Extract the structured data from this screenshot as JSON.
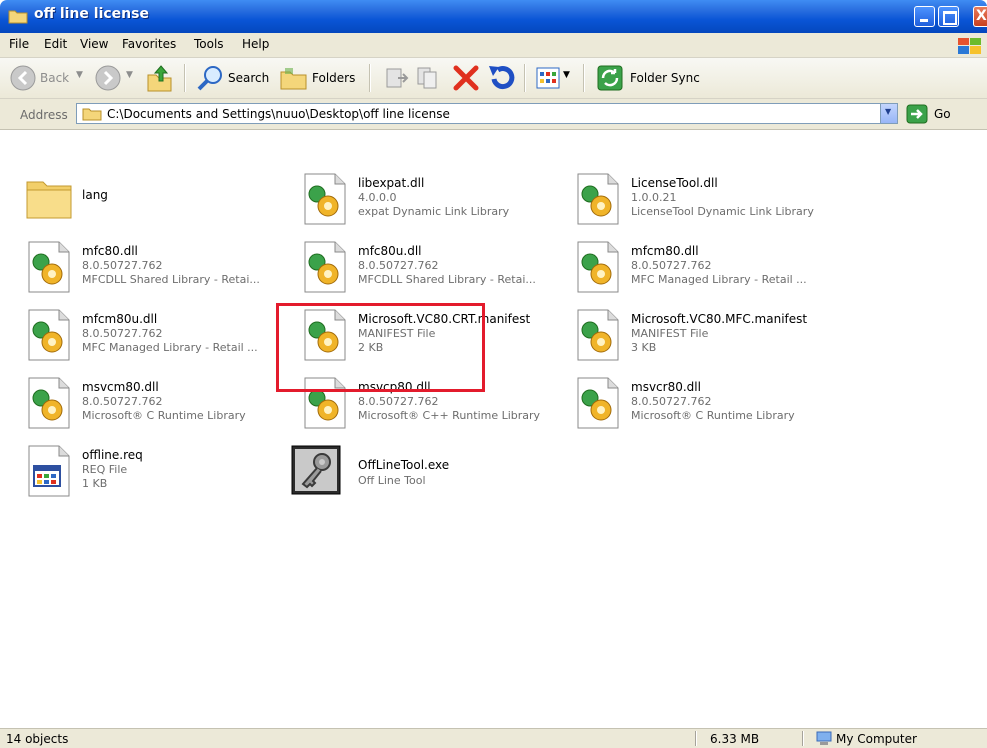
{
  "window": {
    "title": "off line license",
    "accent": "#0a55d6"
  },
  "menu": [
    "File",
    "Edit",
    "View",
    "Favorites",
    "Tools",
    "Help"
  ],
  "toolbar": {
    "back_label": "Back",
    "search_label": "Search",
    "folders_label": "Folders",
    "folder_sync_label": "Folder Sync"
  },
  "address": {
    "label": "Address",
    "path": "C:\\Documents and Settings\\nuuo\\Desktop\\off line license",
    "go_label": "Go"
  },
  "files": [
    {
      "name": "lang",
      "line2": "",
      "line3": "",
      "icon": "folder-icon"
    },
    {
      "name": "libexpat.dll",
      "line2": "4.0.0.0",
      "line3": "expat Dynamic Link Library",
      "icon": "dll-icon"
    },
    {
      "name": "LicenseTool.dll",
      "line2": "1.0.0.21",
      "line3": "LicenseTool Dynamic Link Library",
      "icon": "dll-icon"
    },
    {
      "name": "mfc80.dll",
      "line2": "8.0.50727.762",
      "line3": "MFCDLL Shared Library - Retai...",
      "icon": "dll-icon"
    },
    {
      "name": "mfc80u.dll",
      "line2": "8.0.50727.762",
      "line3": "MFCDLL Shared Library - Retai...",
      "icon": "dll-icon"
    },
    {
      "name": "mfcm80.dll",
      "line2": "8.0.50727.762",
      "line3": "MFC Managed Library - Retail ...",
      "icon": "dll-icon"
    },
    {
      "name": "mfcm80u.dll",
      "line2": "8.0.50727.762",
      "line3": "MFC Managed Library - Retail ...",
      "icon": "dll-icon"
    },
    {
      "name": "Microsoft.VC80.CRT.manifest",
      "line2": "MANIFEST File",
      "line3": "2 KB",
      "icon": "dll-icon"
    },
    {
      "name": "Microsoft.VC80.MFC.manifest",
      "line2": "MANIFEST File",
      "line3": "3 KB",
      "icon": "dll-icon"
    },
    {
      "name": "msvcm80.dll",
      "line2": "8.0.50727.762",
      "line3": "Microsoft® C Runtime Library",
      "icon": "dll-icon"
    },
    {
      "name": "msvcp80.dll",
      "line2": "8.0.50727.762",
      "line3": "Microsoft® C++ Runtime Library",
      "icon": "dll-icon"
    },
    {
      "name": "msvcr80.dll",
      "line2": "8.0.50727.762",
      "line3": "Microsoft® C Runtime Library",
      "icon": "dll-icon"
    },
    {
      "name": "offline.req",
      "line2": "REQ File",
      "line3": "1 KB",
      "icon": "req-file-icon"
    },
    {
      "name": "OffLineTool.exe",
      "line2": "Off Line Tool",
      "line3": "",
      "icon": "key-app-icon"
    }
  ],
  "highlight_color": "#e31b2c",
  "status": {
    "objects": "14 objects",
    "size": "6.33 MB",
    "zone": "My Computer"
  }
}
